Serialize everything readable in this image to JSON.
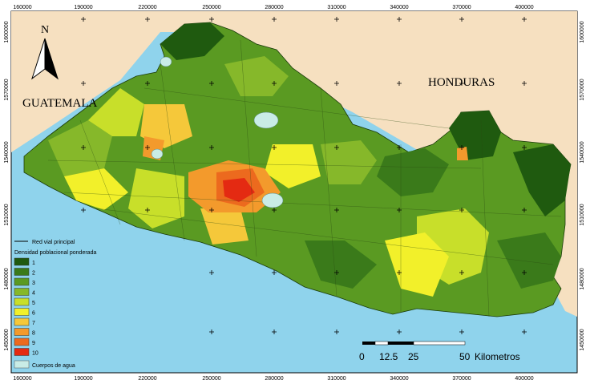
{
  "x_ticks": [
    "160000",
    "190000",
    "220000",
    "250000",
    "280000",
    "310000",
    "340000",
    "370000",
    "400000"
  ],
  "y_ticks": [
    "1600000",
    "1570000",
    "1540000",
    "1510000",
    "1480000",
    "1450000"
  ],
  "countries": {
    "guatemala": "GUATEMALA",
    "honduras": "HONDURAS"
  },
  "north_label": "N",
  "legend": {
    "road_label": "Red vial principal",
    "title": "Densidad poblacional ponderada",
    "classes": [
      {
        "label": "1",
        "color": "#1f5a0f"
      },
      {
        "label": "2",
        "color": "#3a7a1a"
      },
      {
        "label": "3",
        "color": "#5a9a22"
      },
      {
        "label": "4",
        "color": "#86b82a"
      },
      {
        "label": "5",
        "color": "#c8df2a"
      },
      {
        "label": "6",
        "color": "#f2f02a"
      },
      {
        "label": "7",
        "color": "#f5c83a"
      },
      {
        "label": "8",
        "color": "#f39a2c"
      },
      {
        "label": "9",
        "color": "#ec6a1e"
      },
      {
        "label": "10",
        "color": "#e42a12"
      }
    ],
    "water_label": "Cuerpos de agua",
    "water_color": "#c9ece6"
  },
  "scale": {
    "ticks": [
      "0",
      "12.5",
      "25",
      "50"
    ],
    "unit": "Kilometros"
  },
  "colors": {
    "ocean": "#8fd3ec",
    "land_neighbor": "#f6e0c0",
    "border": "#000000"
  }
}
